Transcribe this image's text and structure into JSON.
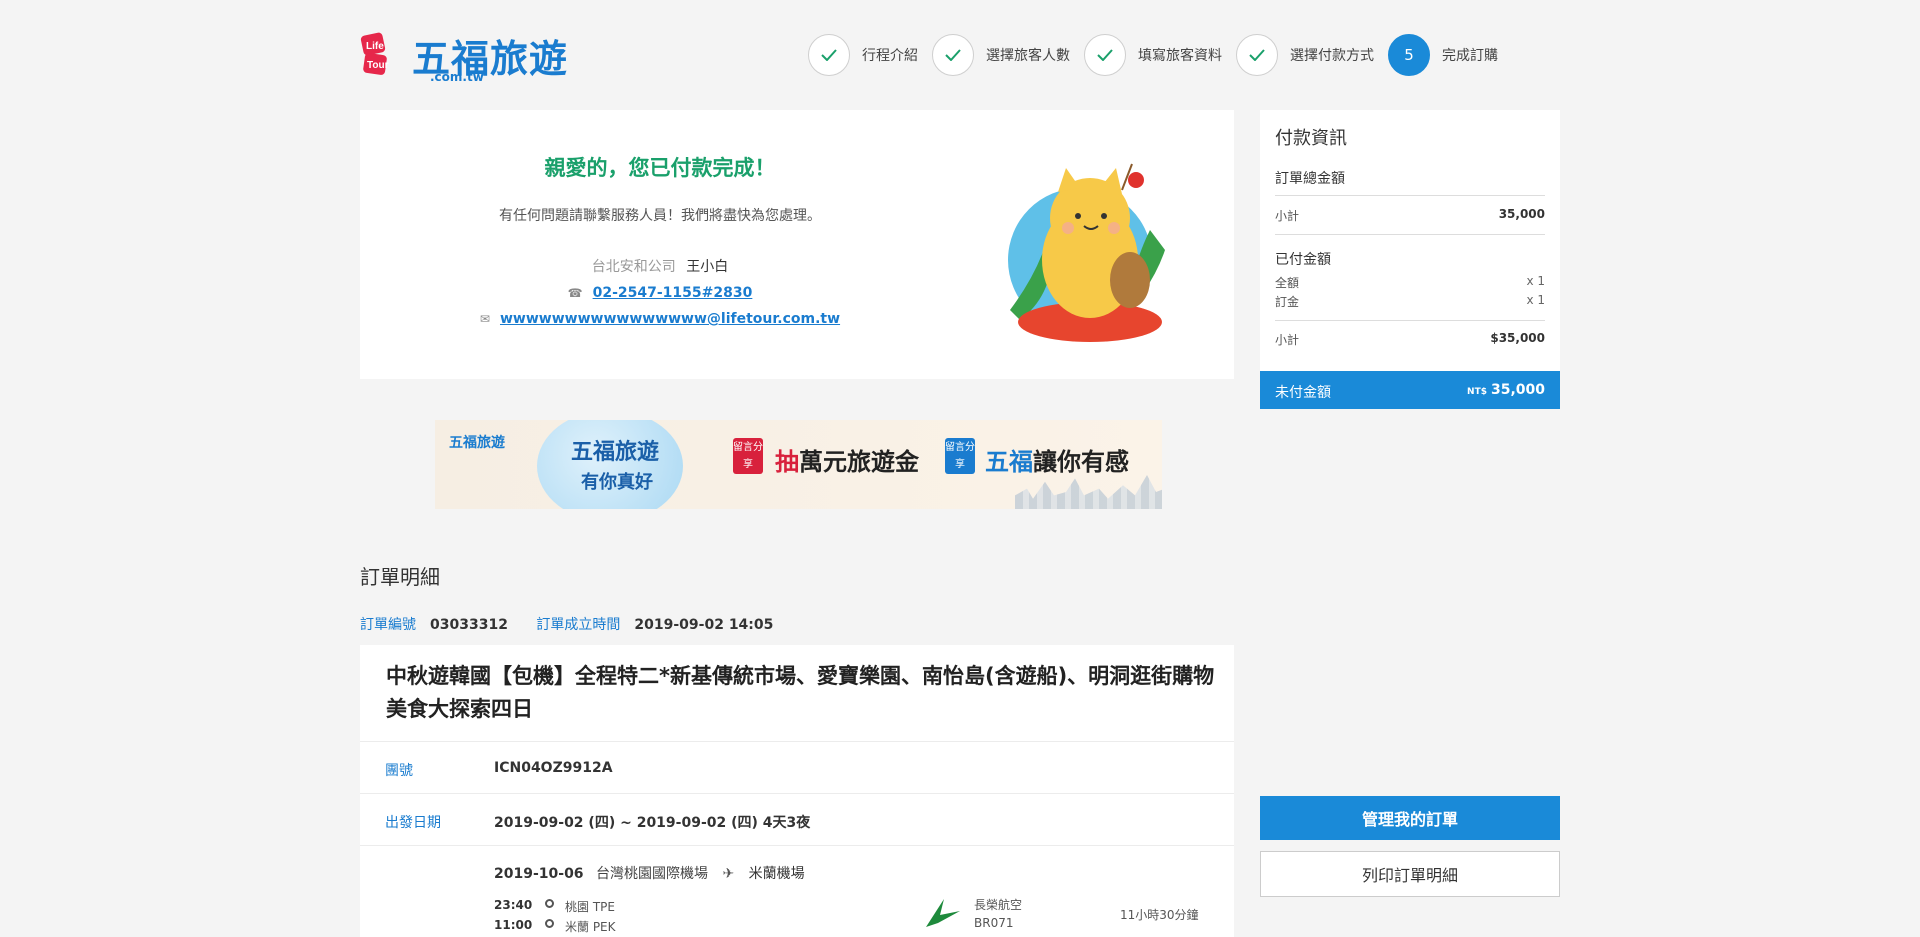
{
  "header": {
    "logo_badge": "Life Tour",
    "brand": "五福旅遊",
    "domain": ".com.tw",
    "steps": [
      {
        "label": "行程介紹",
        "done": true
      },
      {
        "label": "選擇旅客人數",
        "done": true
      },
      {
        "label": "填寫旅客資料",
        "done": true
      },
      {
        "label": "選擇付款方式",
        "done": true
      },
      {
        "label": "完成訂購",
        "number": "5",
        "done": false
      }
    ]
  },
  "confirmation": {
    "title": "親愛的，您已付款完成！",
    "subtitle": "有任何問題請聯繫服務人員！我們將盡快為您處理。",
    "company": "台北安和公司",
    "agent": "王小白",
    "phone": "02-2547-1155#2830",
    "email": "wwwwwwwwwwwwwwww@lifetour.com.tw",
    "icons": {
      "phone": "phone-icon",
      "email": "mail-icon"
    }
  },
  "banner": {
    "logo": "五福旅遊",
    "slogan_line1": "五福旅遊",
    "slogan_line2": "有你真好",
    "tag1": "留言分享",
    "campaign1_red": "抽",
    "campaign1": "萬元旅遊金",
    "tag2": "留言分享",
    "campaign2_blue": "五福",
    "campaign2": "讓你有感"
  },
  "order": {
    "section_title": "訂單明細",
    "number_label": "訂單編號",
    "number": "03033312",
    "created_label": "訂單成立時間",
    "created": "2019-09-02 14:05",
    "tour_name": "中秋遊韓國【包機】全程特二*新基傳統市場、愛寶樂園、南怡島(含遊船)、明洞逛街購物美食大探索四日",
    "group_label": "團號",
    "group_code": "ICN04OZ9912A",
    "depart_label": "出發日期",
    "depart": "2019-09-02 (四) ~ 2019-09-02 (四) 4天3夜",
    "flight": {
      "date": "2019-10-06",
      "from": "台灣桃園國際機場",
      "to": "米蘭機場",
      "dep_time": "23:40",
      "dep_city": "桃園 TPE",
      "arr_time": "11:00",
      "arr_city": "米蘭 PEK",
      "airline": "長榮航空",
      "flight_no": "BR071",
      "duration": "11小時30分鐘"
    }
  },
  "payment": {
    "title": "付款資訊",
    "total_label": "訂單總金額",
    "subtotal_label": "小計",
    "subtotal": "35,000",
    "paid_label": "已付金額",
    "full_label": "全額",
    "full_qty": "x 1",
    "deposit_label": "訂金",
    "deposit_qty": "x 1",
    "paid_subtotal_label": "小計",
    "paid_subtotal": "$35,000",
    "unpaid_label": "未付金額",
    "unpaid_currency": "NT$",
    "unpaid": "35,000"
  },
  "actions": {
    "manage": "管理我的訂單",
    "print": "列印訂單明細"
  },
  "colors": {
    "primary": "#1a8ad8",
    "success": "#1aa06b",
    "brand_red": "#d8213c"
  }
}
